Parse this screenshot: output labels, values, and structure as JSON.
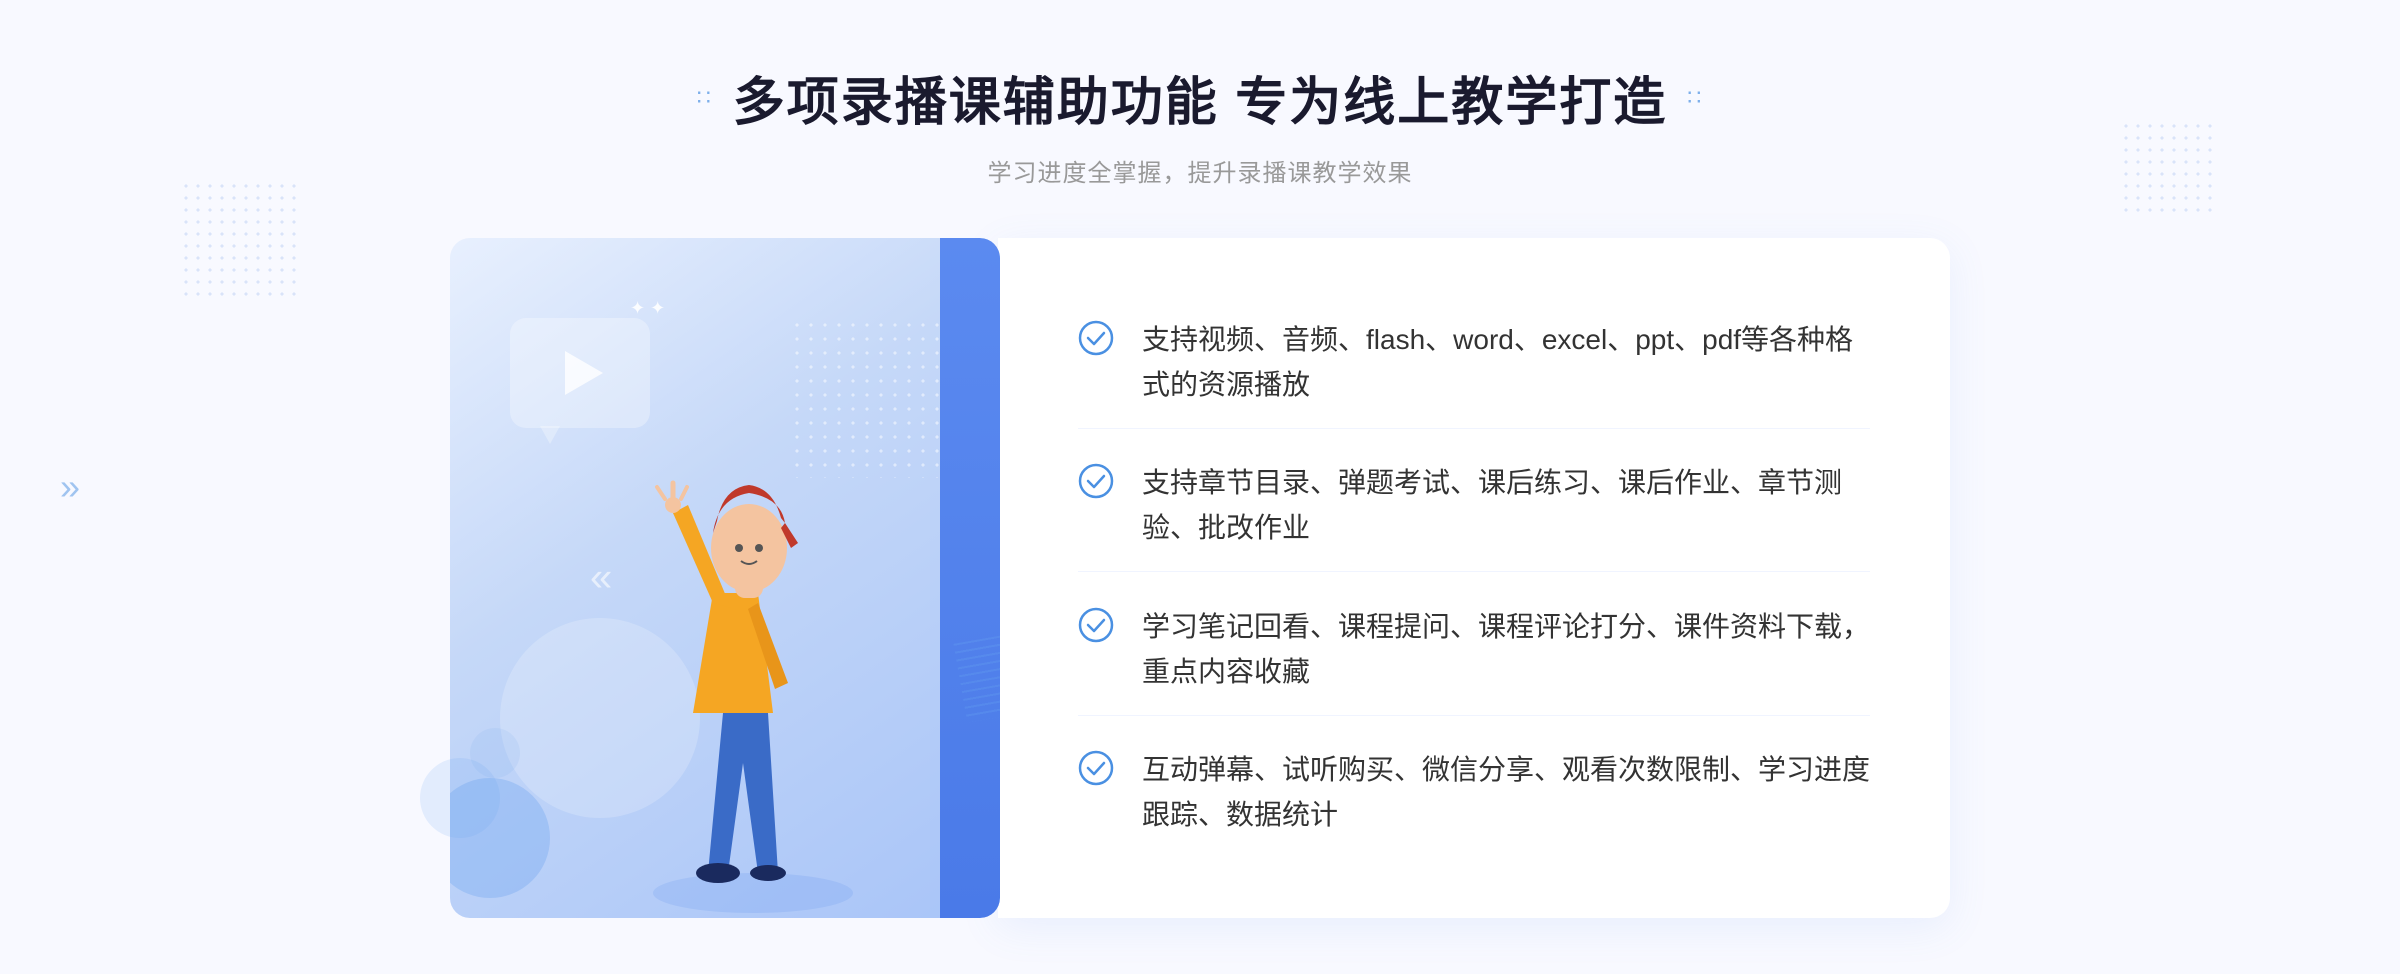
{
  "header": {
    "title_dots_left": "∷",
    "title_dots_right": "∷",
    "main_title": "多项录播课辅助功能 专为线上教学打造",
    "subtitle": "学习进度全掌握，提升录播课教学效果"
  },
  "features": [
    {
      "id": 1,
      "text": "支持视频、音频、flash、word、excel、ppt、pdf等各种格式的资源播放"
    },
    {
      "id": 2,
      "text": "支持章节目录、弹题考试、课后练习、课后作业、章节测验、批改作业"
    },
    {
      "id": 3,
      "text": "学习笔记回看、课程提问、课程评论打分、课件资料下载，重点内容收藏"
    },
    {
      "id": 4,
      "text": "互动弹幕、试听购买、微信分享、观看次数限制、学习进度跟踪、数据统计"
    }
  ],
  "decorations": {
    "arrow_left": "»",
    "play_button_aria": "play"
  }
}
